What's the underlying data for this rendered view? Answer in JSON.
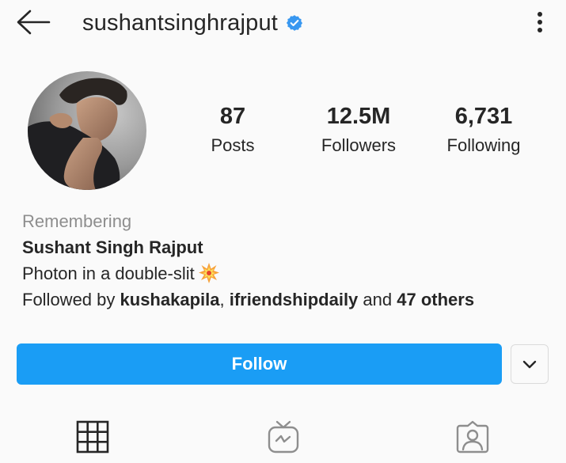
{
  "header": {
    "username": "sushantsinghrajput",
    "icons": {
      "back": "back-arrow-icon",
      "verified": "verified-badge-icon",
      "more": "more-options-icon"
    }
  },
  "profile": {
    "avatar": "profile-photo"
  },
  "stats": [
    {
      "value": "87",
      "label": "Posts"
    },
    {
      "value": "12.5M",
      "label": "Followers"
    },
    {
      "value": "6,731",
      "label": "Following"
    }
  ],
  "bio": {
    "category": "Remembering",
    "name": "Sushant Singh Rajput",
    "text": "Photon in a double-slit",
    "emoji": "collision-emoji",
    "followed_by": {
      "prefix": "Followed by ",
      "user1": "kushakapila",
      "sep": ", ",
      "user2": "ifriendshipdaily",
      "and": " and ",
      "others": "47 others"
    }
  },
  "actions": {
    "follow_label": "Follow",
    "dropdown_icon": "chevron-down-icon"
  },
  "tabs": [
    {
      "icon": "grid-icon",
      "active": true
    },
    {
      "icon": "igtv-icon",
      "active": false
    },
    {
      "icon": "tagged-icon",
      "active": false
    }
  ],
  "colors": {
    "accent": "#1a9df5",
    "verified": "#3897f0",
    "text": "#262626",
    "muted": "#8e8e8e",
    "background": "#fafafa"
  }
}
